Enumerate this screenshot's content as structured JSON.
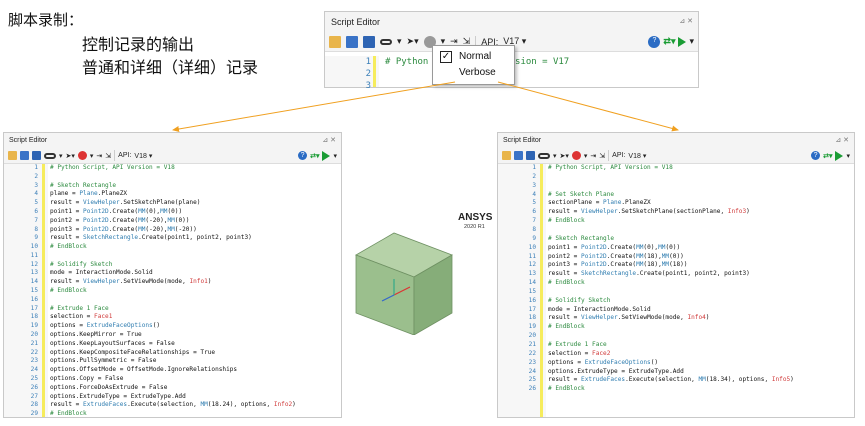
{
  "note": {
    "title": "脚本录制：",
    "line1": "控制记录的输出",
    "line2": "普通和详细（详细）记录"
  },
  "editor_title": "Script Editor",
  "api_label": "API:",
  "popup": {
    "normal": "Normal",
    "verbose": "Verbose"
  },
  "top": {
    "api_version": "V17",
    "lines": [
      "# Python Script, API Version = V17",
      "",
      ""
    ]
  },
  "left": {
    "api_version": "V18",
    "lines": [
      [
        [
          "cm",
          "# Python Script, API Version = V18"
        ]
      ],
      [],
      [
        [
          "cm",
          "# Sketch Rectangle"
        ]
      ],
      [
        [
          "",
          "plane = "
        ],
        [
          "ty",
          "Plane"
        ],
        [
          "",
          ".PlaneZX"
        ]
      ],
      [
        [
          "",
          "result = "
        ],
        [
          "ty",
          "ViewHelper"
        ],
        [
          "",
          ".SetSketchPlane(plane)"
        ]
      ],
      [
        [
          "",
          "point1 = "
        ],
        [
          "ty",
          "Point2D"
        ],
        [
          "",
          ".Create("
        ],
        [
          "fn",
          "MM"
        ],
        [
          "",
          "(0),"
        ],
        [
          "fn",
          "MM"
        ],
        [
          "",
          "(0))"
        ]
      ],
      [
        [
          "",
          "point2 = "
        ],
        [
          "ty",
          "Point2D"
        ],
        [
          "",
          ".Create("
        ],
        [
          "fn",
          "MM"
        ],
        [
          "",
          "(-20),"
        ],
        [
          "fn",
          "MM"
        ],
        [
          "",
          "(0))"
        ]
      ],
      [
        [
          "",
          "point3 = "
        ],
        [
          "ty",
          "Point2D"
        ],
        [
          "",
          ".Create("
        ],
        [
          "fn",
          "MM"
        ],
        [
          "",
          "(-20),"
        ],
        [
          "fn",
          "MM"
        ],
        [
          "",
          "(-20))"
        ]
      ],
      [
        [
          "",
          "result = "
        ],
        [
          "ty",
          "SketchRectangle"
        ],
        [
          "",
          ".Create(point1, point2, point3)"
        ]
      ],
      [
        [
          "cm",
          "# EndBlock"
        ]
      ],
      [],
      [
        [
          "cm",
          "# Solidify Sketch"
        ]
      ],
      [
        [
          "",
          "mode = InteractionMode.Solid"
        ]
      ],
      [
        [
          "",
          "result = "
        ],
        [
          "ty",
          "ViewHelper"
        ],
        [
          "",
          ".SetViewMode(mode, "
        ],
        [
          "in",
          "Info1"
        ],
        [
          "",
          ")"
        ]
      ],
      [
        [
          "cm",
          "# EndBlock"
        ]
      ],
      [],
      [
        [
          "cm",
          "# Extrude 1 Face"
        ]
      ],
      [
        [
          "",
          "selection = "
        ],
        [
          "in",
          "Face1"
        ]
      ],
      [
        [
          "",
          "options = "
        ],
        [
          "ty",
          "ExtrudeFaceOptions"
        ],
        [
          "",
          "()"
        ]
      ],
      [
        [
          "",
          "options.KeepMirror = True"
        ]
      ],
      [
        [
          "",
          "options.KeepLayoutSurfaces = False"
        ]
      ],
      [
        [
          "",
          "options.KeepCompositeFaceRelationships = True"
        ]
      ],
      [
        [
          "",
          "options.PullSymmetric = False"
        ]
      ],
      [
        [
          "",
          "options.OffsetMode = OffsetMode.IgnoreRelationships"
        ]
      ],
      [
        [
          "",
          "options.Copy = False"
        ]
      ],
      [
        [
          "",
          "options.ForceDoAsExtrude = False"
        ]
      ],
      [
        [
          "",
          "options.ExtrudeType = ExtrudeType.Add"
        ]
      ],
      [
        [
          "",
          "result = "
        ],
        [
          "ty",
          "ExtrudeFaces"
        ],
        [
          "",
          ".Execute(selection, "
        ],
        [
          "fn",
          "MM"
        ],
        [
          "",
          "(18.24), options, "
        ],
        [
          "in",
          "Info2"
        ],
        [
          "",
          ")"
        ]
      ],
      [
        [
          "cm",
          "# EndBlock"
        ]
      ]
    ]
  },
  "right": {
    "api_version": "V18",
    "lines": [
      [
        [
          "cm",
          "# Python Script, API Version = V18"
        ]
      ],
      [],
      [],
      [
        [
          "cm",
          "# Set Sketch Plane"
        ]
      ],
      [
        [
          "",
          "sectionPlane = "
        ],
        [
          "ty",
          "Plane"
        ],
        [
          "",
          ".PlaneZX"
        ]
      ],
      [
        [
          "",
          "result = "
        ],
        [
          "ty",
          "ViewHelper"
        ],
        [
          "",
          ".SetSketchPlane(sectionPlane, "
        ],
        [
          "in",
          "Info3"
        ],
        [
          "",
          ")"
        ]
      ],
      [
        [
          "cm",
          "# EndBlock"
        ]
      ],
      [],
      [
        [
          "cm",
          "# Sketch Rectangle"
        ]
      ],
      [
        [
          "",
          "point1 = "
        ],
        [
          "ty",
          "Point2D"
        ],
        [
          "",
          ".Create("
        ],
        [
          "fn",
          "MM"
        ],
        [
          "",
          "(0),"
        ],
        [
          "fn",
          "MM"
        ],
        [
          "",
          "(0))"
        ]
      ],
      [
        [
          "",
          "point2 = "
        ],
        [
          "ty",
          "Point2D"
        ],
        [
          "",
          ".Create("
        ],
        [
          "fn",
          "MM"
        ],
        [
          "",
          "(18),"
        ],
        [
          "fn",
          "MM"
        ],
        [
          "",
          "(0))"
        ]
      ],
      [
        [
          "",
          "point3 = "
        ],
        [
          "ty",
          "Point2D"
        ],
        [
          "",
          ".Create("
        ],
        [
          "fn",
          "MM"
        ],
        [
          "",
          "(18),"
        ],
        [
          "fn",
          "MM"
        ],
        [
          "",
          "(18))"
        ]
      ],
      [
        [
          "",
          "result = "
        ],
        [
          "ty",
          "SketchRectangle"
        ],
        [
          "",
          ".Create(point1, point2, point3)"
        ]
      ],
      [
        [
          "cm",
          "# EndBlock"
        ]
      ],
      [],
      [
        [
          "cm",
          "# Solidify Sketch"
        ]
      ],
      [
        [
          "",
          "mode = InteractionMode.Solid"
        ]
      ],
      [
        [
          "",
          "result = "
        ],
        [
          "ty",
          "ViewHelper"
        ],
        [
          "",
          ".SetViewMode(mode, "
        ],
        [
          "in",
          "Info4"
        ],
        [
          "",
          ")"
        ]
      ],
      [
        [
          "cm",
          "# EndBlock"
        ]
      ],
      [],
      [
        [
          "cm",
          "# Extrude 1 Face"
        ]
      ],
      [
        [
          "",
          "selection = "
        ],
        [
          "in",
          "Face2"
        ]
      ],
      [
        [
          "",
          "options = "
        ],
        [
          "ty",
          "ExtrudeFaceOptions"
        ],
        [
          "",
          "()"
        ]
      ],
      [
        [
          "",
          "options.ExtrudeType = ExtrudeType.Add"
        ]
      ],
      [
        [
          "",
          "result = "
        ],
        [
          "ty",
          "ExtrudeFaces"
        ],
        [
          "",
          ".Execute(selection, "
        ],
        [
          "fn",
          "MM"
        ],
        [
          "",
          "(18.34), options, "
        ],
        [
          "in",
          "Info5"
        ],
        [
          "",
          ")"
        ]
      ],
      [
        [
          "cm",
          "# EndBlock"
        ]
      ]
    ]
  },
  "ansys": {
    "brand": "ANSYS",
    "version": "2020 R1"
  },
  "colors": {
    "gutter_bar": "#f6ec5c",
    "comment": "#2b8a3e",
    "type": "#2f7db0",
    "info": "#d03a3a",
    "line_number": "#3b7fb8",
    "arrow": "#f0a020",
    "cube_front": "#9bbf8d",
    "cube_top": "#b6d2a8",
    "cube_side": "#86ad79"
  },
  "icons": [
    "open-folder-icon",
    "save-icon",
    "save-all-icon",
    "link-icon",
    "select-arrow-icon",
    "record-icon",
    "step-icon",
    "step-over-icon",
    "help-icon",
    "script-output-icon",
    "run-icon"
  ]
}
